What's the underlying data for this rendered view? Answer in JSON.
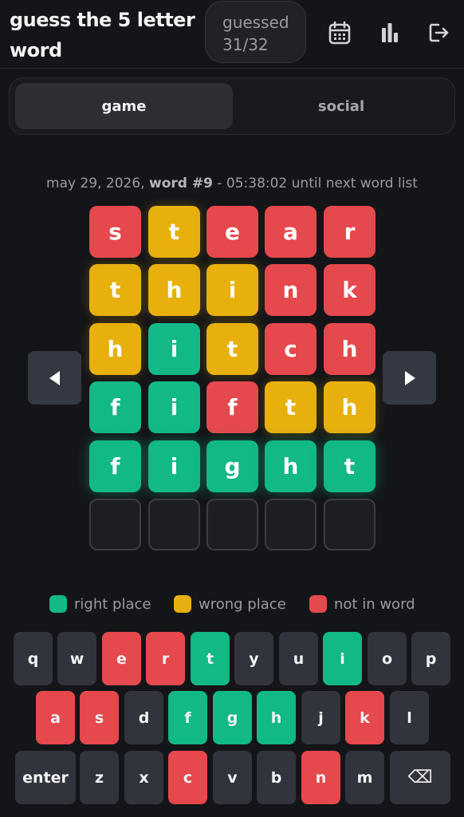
{
  "header": {
    "title": "guess the 5 letter word",
    "guessed_label": "guessed",
    "guessed_count": "31/32",
    "icons": [
      "calendar-icon",
      "stats-icon",
      "logout-icon"
    ]
  },
  "tabs": [
    {
      "label": "game",
      "active": true
    },
    {
      "label": "social",
      "active": false
    }
  ],
  "date_line": {
    "date": "may 29, 2026,",
    "word": "word #9",
    "rest": "- 05:38:02 until next word list"
  },
  "board": {
    "rows": [
      [
        [
          "s",
          "absent"
        ],
        [
          "t",
          "wrong"
        ],
        [
          "e",
          "absent"
        ],
        [
          "a",
          "absent"
        ],
        [
          "r",
          "absent"
        ]
      ],
      [
        [
          "t",
          "wrong"
        ],
        [
          "h",
          "wrong"
        ],
        [
          "i",
          "wrong"
        ],
        [
          "n",
          "absent"
        ],
        [
          "k",
          "absent"
        ]
      ],
      [
        [
          "h",
          "wrong"
        ],
        [
          "i",
          "right"
        ],
        [
          "t",
          "wrong"
        ],
        [
          "c",
          "absent"
        ],
        [
          "h",
          "absent"
        ]
      ],
      [
        [
          "f",
          "right"
        ],
        [
          "i",
          "right"
        ],
        [
          "f",
          "absent"
        ],
        [
          "t",
          "wrong"
        ],
        [
          "h",
          "wrong"
        ]
      ],
      [
        [
          "f",
          "right"
        ],
        [
          "i",
          "right"
        ],
        [
          "g",
          "right"
        ],
        [
          "h",
          "right"
        ],
        [
          "t",
          "right"
        ]
      ],
      [
        [
          "",
          "empty"
        ],
        [
          "",
          "empty"
        ],
        [
          "",
          "empty"
        ],
        [
          "",
          "empty"
        ],
        [
          "",
          "empty"
        ]
      ]
    ]
  },
  "legend": {
    "right": "right place",
    "wrong": "wrong place",
    "absent": "not in word"
  },
  "colors": {
    "right": "#12b886",
    "wrong": "#e7b00d",
    "absent": "#e5484d",
    "key": "#31343c",
    "background": "#141518"
  },
  "keyboard": {
    "row1": [
      [
        "q",
        ""
      ],
      [
        "w",
        ""
      ],
      [
        "e",
        "absent"
      ],
      [
        "r",
        "absent"
      ],
      [
        "t",
        "right"
      ],
      [
        "y",
        ""
      ],
      [
        "u",
        ""
      ],
      [
        "i",
        "right"
      ],
      [
        "o",
        ""
      ],
      [
        "p",
        ""
      ]
    ],
    "row2": [
      [
        "a",
        "absent"
      ],
      [
        "s",
        "absent"
      ],
      [
        "d",
        ""
      ],
      [
        "f",
        "right"
      ],
      [
        "g",
        "right"
      ],
      [
        "h",
        "right"
      ],
      [
        "j",
        ""
      ],
      [
        "k",
        "absent"
      ],
      [
        "l",
        ""
      ]
    ],
    "row3": [
      [
        "enter",
        ""
      ],
      [
        "z",
        ""
      ],
      [
        "x",
        ""
      ],
      [
        "c",
        "absent"
      ],
      [
        "v",
        ""
      ],
      [
        "b",
        ""
      ],
      [
        "n",
        "absent"
      ],
      [
        "m",
        ""
      ],
      [
        "⌫",
        ""
      ]
    ]
  }
}
